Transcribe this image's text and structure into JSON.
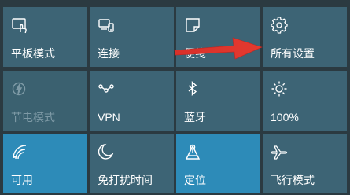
{
  "tiles": [
    {
      "label": "平板模式",
      "icon": "tablet-mode-icon",
      "state": "normal"
    },
    {
      "label": "连接",
      "icon": "connect-icon",
      "state": "normal"
    },
    {
      "label": "便笺",
      "icon": "note-icon",
      "state": "normal"
    },
    {
      "label": "所有设置",
      "icon": "gear-icon",
      "state": "normal"
    },
    {
      "label": "节电模式",
      "icon": "battery-saver-icon",
      "state": "disabled"
    },
    {
      "label": "VPN",
      "icon": "vpn-icon",
      "state": "normal"
    },
    {
      "label": "蓝牙",
      "icon": "bluetooth-icon",
      "state": "normal"
    },
    {
      "label": "100%",
      "icon": "brightness-icon",
      "state": "normal"
    },
    {
      "label": "可用",
      "icon": "wifi-icon",
      "state": "active"
    },
    {
      "label": "免打扰时间",
      "icon": "moon-icon",
      "state": "normal"
    },
    {
      "label": "定位",
      "icon": "location-icon",
      "state": "active"
    },
    {
      "label": "飞行模式",
      "icon": "airplane-icon",
      "state": "normal"
    }
  ],
  "colors": {
    "background": "#2b3a41",
    "tile": "#3d6475",
    "tile_active": "#2d8bb8",
    "arrow": "#e0322c"
  }
}
